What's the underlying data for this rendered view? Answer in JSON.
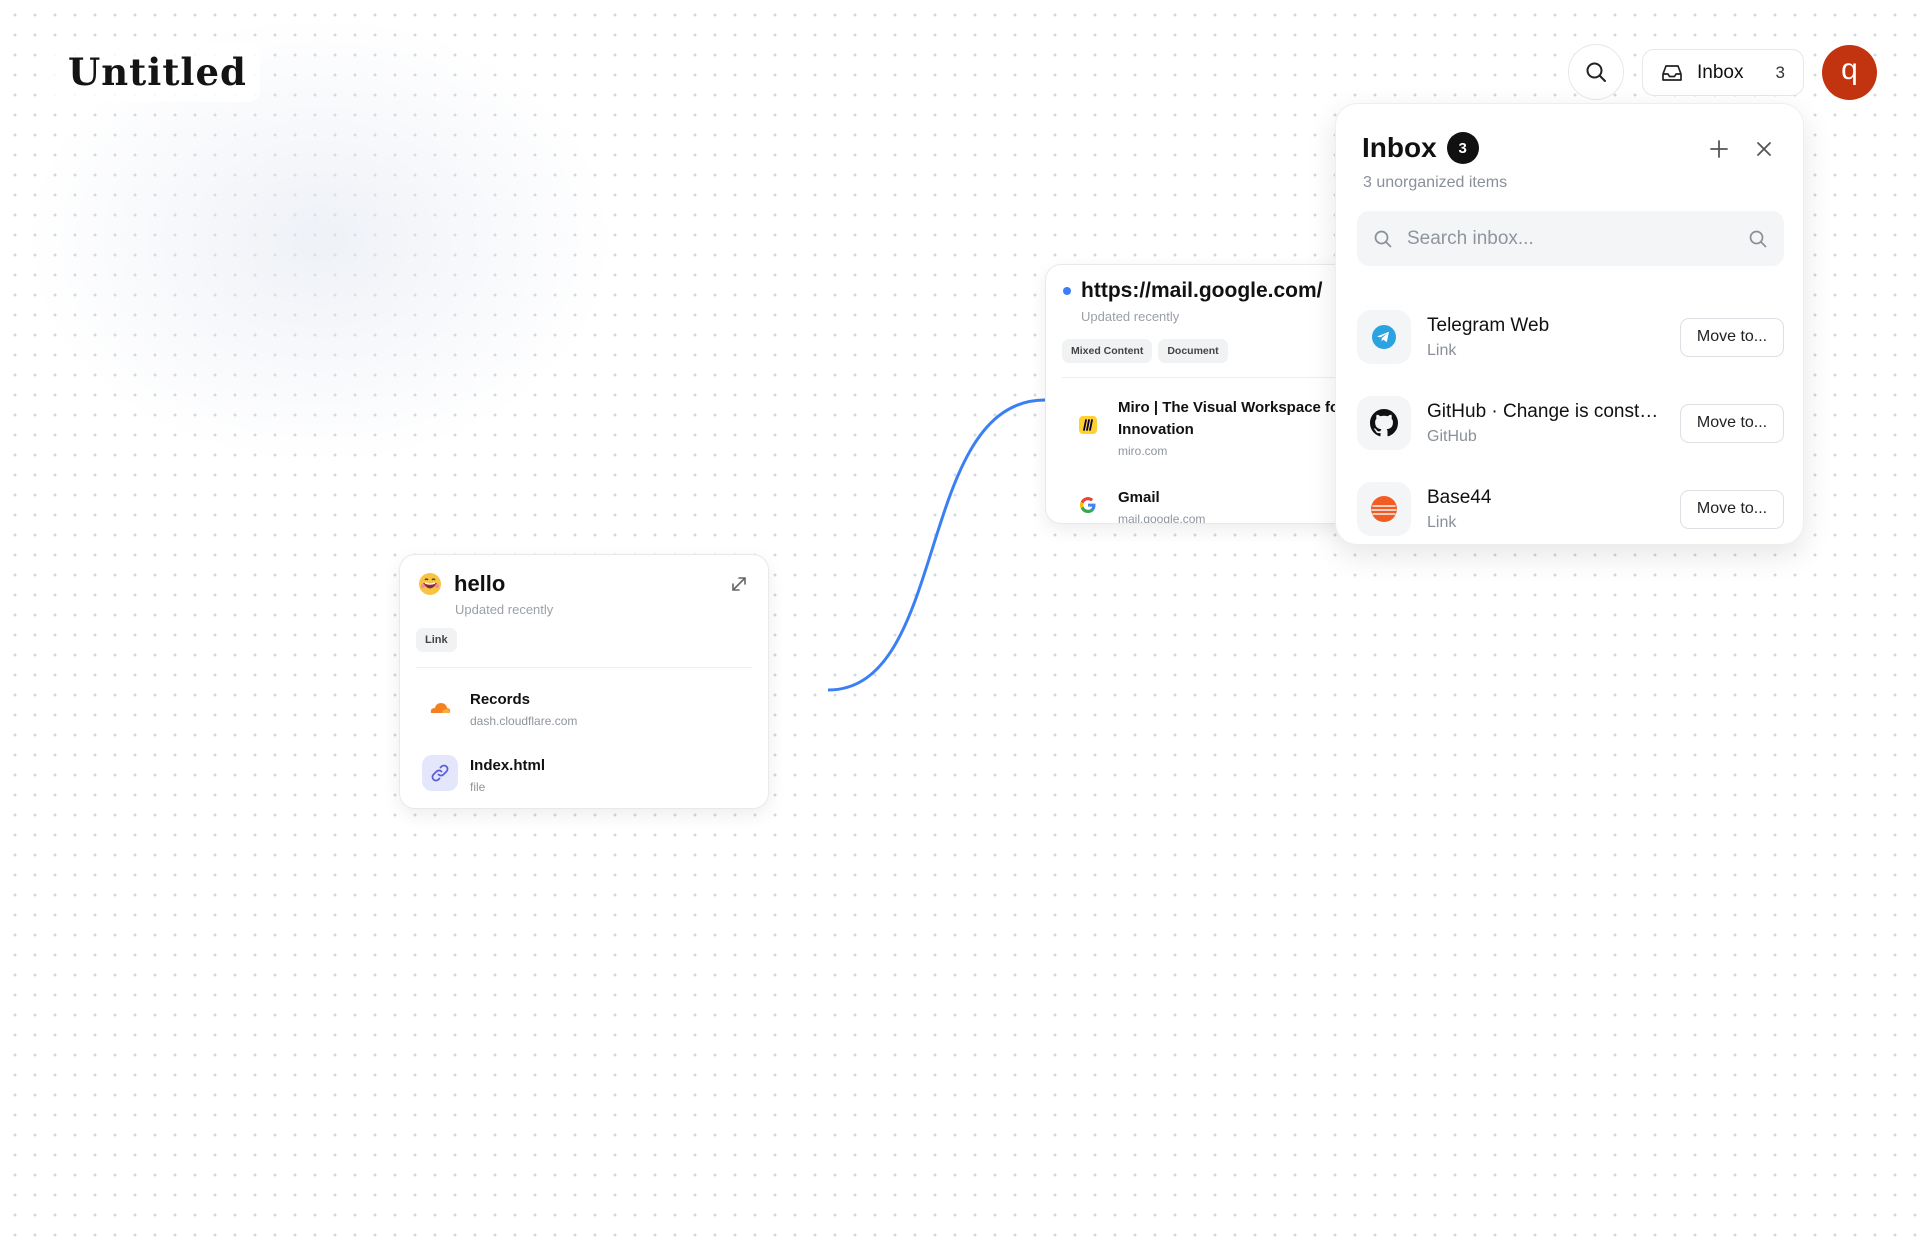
{
  "document": {
    "title": "Untitled"
  },
  "header": {
    "inbox_label": "Inbox",
    "inbox_count": "3",
    "avatar_initial": "q"
  },
  "cards": {
    "hello": {
      "title": "hello",
      "updated": "Updated recently",
      "tags": [
        "Link"
      ],
      "items": [
        {
          "name": "Records",
          "sub": "dash.cloudflare.com",
          "icon": "cloudflare-icon"
        },
        {
          "name": "Index.html",
          "sub": "file",
          "icon": "link-icon"
        }
      ]
    },
    "mail": {
      "title": "https://mail.google.com/",
      "updated": "Updated recently",
      "tags": [
        "Mixed Content",
        "Document"
      ],
      "items": [
        {
          "name": "Miro | The Visual Workspace for Innovation",
          "sub": "miro.com",
          "icon": "miro-icon"
        },
        {
          "name": "Gmail",
          "sub": "mail.google.com",
          "icon": "google-icon"
        }
      ]
    }
  },
  "inbox": {
    "title": "Inbox",
    "count": "3",
    "subtitle": "3 unorganized items",
    "search_placeholder": "Search inbox...",
    "items": [
      {
        "name": "Telegram Web",
        "type": "Link",
        "icon": "telegram-icon",
        "action": "Move to..."
      },
      {
        "name": "GitHub · Change is constant. GitHub keeps you ahead.",
        "type": "GitHub",
        "icon": "github-icon",
        "action": "Move to..."
      },
      {
        "name": "Base44",
        "type": "Link",
        "icon": "base44-icon",
        "action": "Move to..."
      }
    ]
  },
  "colors": {
    "accent": "#3b7ff5",
    "avatar": "#c2330f",
    "connector": "#3b7ff5"
  }
}
